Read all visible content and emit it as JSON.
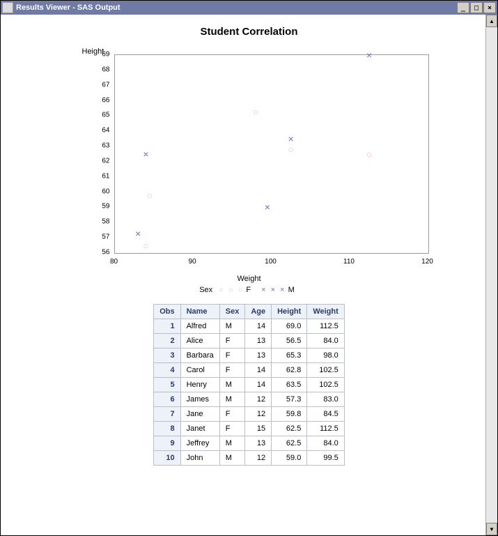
{
  "window_title": "Results Viewer - SAS Output",
  "chart_data": {
    "type": "scatter",
    "title": "Student Correlation",
    "xlabel": "Weight",
    "ylabel": "Height",
    "xlim": [
      80,
      120
    ],
    "ylim": [
      56,
      69
    ],
    "xticks": [
      80,
      90,
      100,
      110,
      120
    ],
    "yticks": [
      56,
      57,
      58,
      59,
      60,
      61,
      62,
      63,
      64,
      65,
      66,
      67,
      68,
      69
    ],
    "series": [
      {
        "name": "F",
        "marker": "o",
        "color": "#f6b9c4",
        "points": [
          {
            "x": 84.0,
            "y": 56.5
          },
          {
            "x": 98.0,
            "y": 65.3
          },
          {
            "x": 102.5,
            "y": 62.8
          },
          {
            "x": 84.5,
            "y": 59.8
          },
          {
            "x": 112.5,
            "y": 62.5
          }
        ]
      },
      {
        "name": "M",
        "marker": "x",
        "color": "#6d6db8",
        "points": [
          {
            "x": 112.5,
            "y": 69.0
          },
          {
            "x": 102.5,
            "y": 63.5
          },
          {
            "x": 83.0,
            "y": 57.3
          },
          {
            "x": 84.0,
            "y": 62.5
          },
          {
            "x": 99.5,
            "y": 59.0
          }
        ]
      }
    ],
    "legend_title": "Sex"
  },
  "table": {
    "headers": [
      "Obs",
      "Name",
      "Sex",
      "Age",
      "Height",
      "Weight"
    ],
    "rows": [
      {
        "obs": 1,
        "name": "Alfred",
        "sex": "M",
        "age": 14,
        "height": "69.0",
        "weight": "112.5"
      },
      {
        "obs": 2,
        "name": "Alice",
        "sex": "F",
        "age": 13,
        "height": "56.5",
        "weight": "84.0"
      },
      {
        "obs": 3,
        "name": "Barbara",
        "sex": "F",
        "age": 13,
        "height": "65.3",
        "weight": "98.0"
      },
      {
        "obs": 4,
        "name": "Carol",
        "sex": "F",
        "age": 14,
        "height": "62.8",
        "weight": "102.5"
      },
      {
        "obs": 5,
        "name": "Henry",
        "sex": "M",
        "age": 14,
        "height": "63.5",
        "weight": "102.5"
      },
      {
        "obs": 6,
        "name": "James",
        "sex": "M",
        "age": 12,
        "height": "57.3",
        "weight": "83.0"
      },
      {
        "obs": 7,
        "name": "Jane",
        "sex": "F",
        "age": 12,
        "height": "59.8",
        "weight": "84.5"
      },
      {
        "obs": 8,
        "name": "Janet",
        "sex": "F",
        "age": 15,
        "height": "62.5",
        "weight": "112.5"
      },
      {
        "obs": 9,
        "name": "Jeffrey",
        "sex": "M",
        "age": 13,
        "height": "62.5",
        "weight": "84.0"
      },
      {
        "obs": 10,
        "name": "John",
        "sex": "M",
        "age": 12,
        "height": "59.0",
        "weight": "99.5"
      }
    ]
  }
}
